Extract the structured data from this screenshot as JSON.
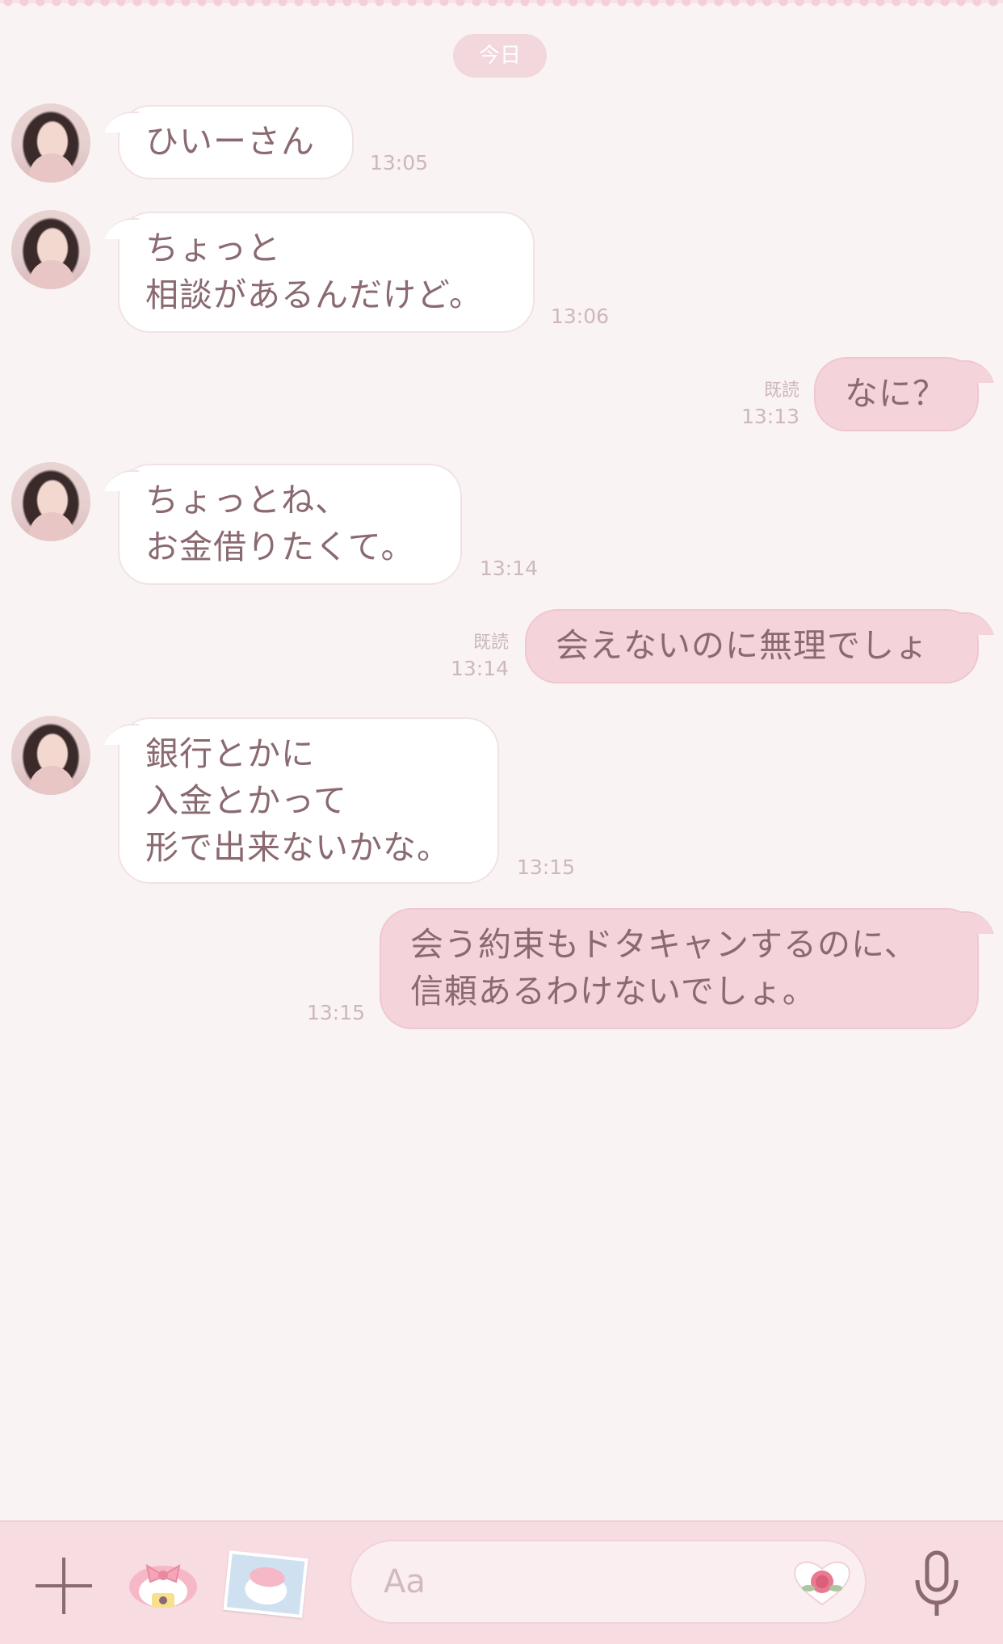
{
  "date_label": "今日",
  "messages": [
    {
      "side": "in",
      "text": "ひいーさん",
      "time": "13:05"
    },
    {
      "side": "in",
      "text": "ちょっと\n相談があるんだけど。",
      "time": "13:06"
    },
    {
      "side": "out",
      "text": "なに？",
      "read": "既読",
      "time": "13:13"
    },
    {
      "side": "in",
      "text": "ちょっとね、\nお金借りたくて。",
      "time": "13:14"
    },
    {
      "side": "out",
      "text": "会えないのに無理でしょ",
      "read": "既読",
      "time": "13:14"
    },
    {
      "side": "in",
      "text": "銀行とかに\n入金とかって\n形で出来ないかな。",
      "time": "13:15"
    },
    {
      "side": "out",
      "text": "会う約束もドタキャンするのに、\n信頼あるわけないでしょ。",
      "time": "13:15"
    }
  ],
  "composer": {
    "placeholder": "Aa",
    "icons": [
      "plus-icon",
      "sticker-icon",
      "photo-icon",
      "heart-emoji-icon",
      "microphone-icon"
    ]
  },
  "colors": {
    "background": "#faf3f3",
    "incoming_bubble": "#ffffff",
    "outgoing_bubble": "#f5d3da",
    "text": "#8a6a70",
    "timestamp": "#cdb7bb",
    "bottom_bar": "#f7dde2"
  }
}
